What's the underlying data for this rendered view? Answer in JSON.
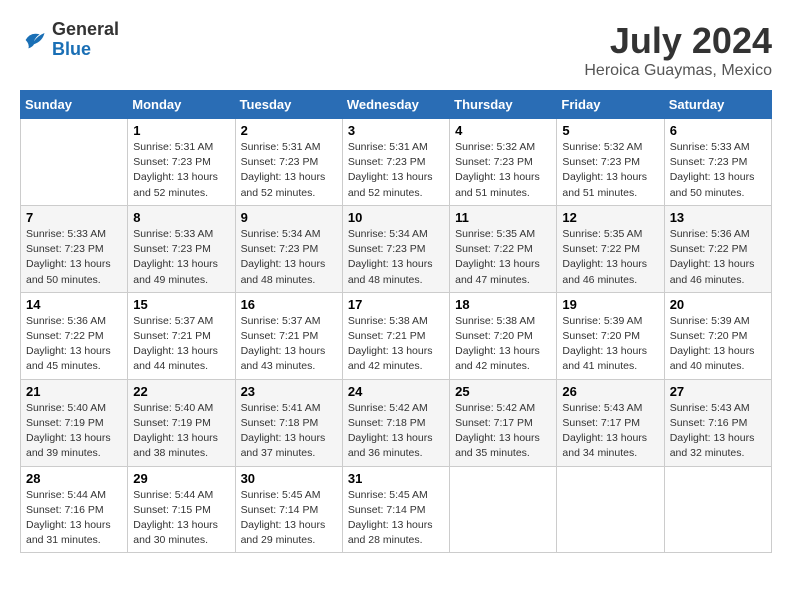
{
  "header": {
    "logo_general": "General",
    "logo_blue": "Blue",
    "month_year": "July 2024",
    "location": "Heroica Guaymas, Mexico"
  },
  "days_of_week": [
    "Sunday",
    "Monday",
    "Tuesday",
    "Wednesday",
    "Thursday",
    "Friday",
    "Saturday"
  ],
  "weeks": [
    [
      {
        "day": "",
        "info": ""
      },
      {
        "day": "1",
        "info": "Sunrise: 5:31 AM\nSunset: 7:23 PM\nDaylight: 13 hours\nand 52 minutes."
      },
      {
        "day": "2",
        "info": "Sunrise: 5:31 AM\nSunset: 7:23 PM\nDaylight: 13 hours\nand 52 minutes."
      },
      {
        "day": "3",
        "info": "Sunrise: 5:31 AM\nSunset: 7:23 PM\nDaylight: 13 hours\nand 52 minutes."
      },
      {
        "day": "4",
        "info": "Sunrise: 5:32 AM\nSunset: 7:23 PM\nDaylight: 13 hours\nand 51 minutes."
      },
      {
        "day": "5",
        "info": "Sunrise: 5:32 AM\nSunset: 7:23 PM\nDaylight: 13 hours\nand 51 minutes."
      },
      {
        "day": "6",
        "info": "Sunrise: 5:33 AM\nSunset: 7:23 PM\nDaylight: 13 hours\nand 50 minutes."
      }
    ],
    [
      {
        "day": "7",
        "info": "Sunrise: 5:33 AM\nSunset: 7:23 PM\nDaylight: 13 hours\nand 50 minutes."
      },
      {
        "day": "8",
        "info": "Sunrise: 5:33 AM\nSunset: 7:23 PM\nDaylight: 13 hours\nand 49 minutes."
      },
      {
        "day": "9",
        "info": "Sunrise: 5:34 AM\nSunset: 7:23 PM\nDaylight: 13 hours\nand 48 minutes."
      },
      {
        "day": "10",
        "info": "Sunrise: 5:34 AM\nSunset: 7:23 PM\nDaylight: 13 hours\nand 48 minutes."
      },
      {
        "day": "11",
        "info": "Sunrise: 5:35 AM\nSunset: 7:22 PM\nDaylight: 13 hours\nand 47 minutes."
      },
      {
        "day": "12",
        "info": "Sunrise: 5:35 AM\nSunset: 7:22 PM\nDaylight: 13 hours\nand 46 minutes."
      },
      {
        "day": "13",
        "info": "Sunrise: 5:36 AM\nSunset: 7:22 PM\nDaylight: 13 hours\nand 46 minutes."
      }
    ],
    [
      {
        "day": "14",
        "info": "Sunrise: 5:36 AM\nSunset: 7:22 PM\nDaylight: 13 hours\nand 45 minutes."
      },
      {
        "day": "15",
        "info": "Sunrise: 5:37 AM\nSunset: 7:21 PM\nDaylight: 13 hours\nand 44 minutes."
      },
      {
        "day": "16",
        "info": "Sunrise: 5:37 AM\nSunset: 7:21 PM\nDaylight: 13 hours\nand 43 minutes."
      },
      {
        "day": "17",
        "info": "Sunrise: 5:38 AM\nSunset: 7:21 PM\nDaylight: 13 hours\nand 42 minutes."
      },
      {
        "day": "18",
        "info": "Sunrise: 5:38 AM\nSunset: 7:20 PM\nDaylight: 13 hours\nand 42 minutes."
      },
      {
        "day": "19",
        "info": "Sunrise: 5:39 AM\nSunset: 7:20 PM\nDaylight: 13 hours\nand 41 minutes."
      },
      {
        "day": "20",
        "info": "Sunrise: 5:39 AM\nSunset: 7:20 PM\nDaylight: 13 hours\nand 40 minutes."
      }
    ],
    [
      {
        "day": "21",
        "info": "Sunrise: 5:40 AM\nSunset: 7:19 PM\nDaylight: 13 hours\nand 39 minutes."
      },
      {
        "day": "22",
        "info": "Sunrise: 5:40 AM\nSunset: 7:19 PM\nDaylight: 13 hours\nand 38 minutes."
      },
      {
        "day": "23",
        "info": "Sunrise: 5:41 AM\nSunset: 7:18 PM\nDaylight: 13 hours\nand 37 minutes."
      },
      {
        "day": "24",
        "info": "Sunrise: 5:42 AM\nSunset: 7:18 PM\nDaylight: 13 hours\nand 36 minutes."
      },
      {
        "day": "25",
        "info": "Sunrise: 5:42 AM\nSunset: 7:17 PM\nDaylight: 13 hours\nand 35 minutes."
      },
      {
        "day": "26",
        "info": "Sunrise: 5:43 AM\nSunset: 7:17 PM\nDaylight: 13 hours\nand 34 minutes."
      },
      {
        "day": "27",
        "info": "Sunrise: 5:43 AM\nSunset: 7:16 PM\nDaylight: 13 hours\nand 32 minutes."
      }
    ],
    [
      {
        "day": "28",
        "info": "Sunrise: 5:44 AM\nSunset: 7:16 PM\nDaylight: 13 hours\nand 31 minutes."
      },
      {
        "day": "29",
        "info": "Sunrise: 5:44 AM\nSunset: 7:15 PM\nDaylight: 13 hours\nand 30 minutes."
      },
      {
        "day": "30",
        "info": "Sunrise: 5:45 AM\nSunset: 7:14 PM\nDaylight: 13 hours\nand 29 minutes."
      },
      {
        "day": "31",
        "info": "Sunrise: 5:45 AM\nSunset: 7:14 PM\nDaylight: 13 hours\nand 28 minutes."
      },
      {
        "day": "",
        "info": ""
      },
      {
        "day": "",
        "info": ""
      },
      {
        "day": "",
        "info": ""
      }
    ]
  ]
}
